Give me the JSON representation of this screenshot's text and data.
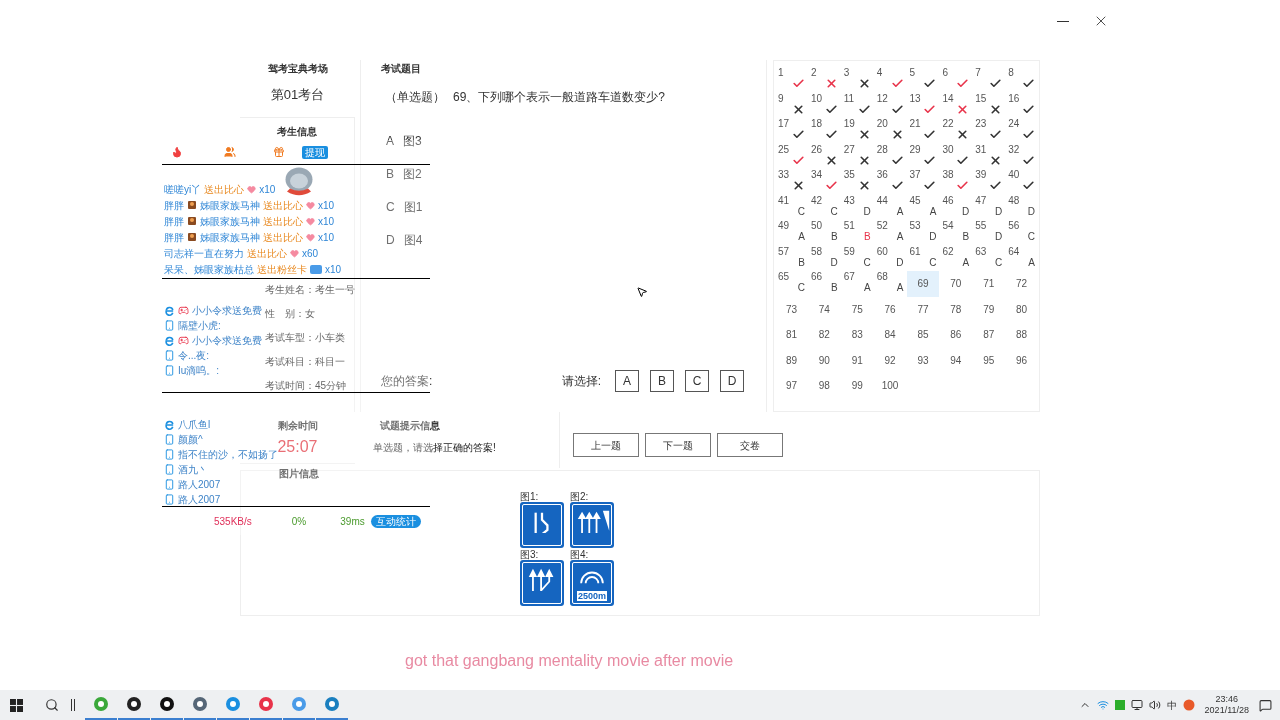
{
  "exam": {
    "site_title": "驾考宝典考场",
    "station": "第01考台",
    "candidate_heading": "考生信息",
    "candidate_fields": [
      {
        "label": "考生姓名：",
        "value": "考生一号"
      },
      {
        "label": "性　别：",
        "value": "女"
      },
      {
        "label": "考试车型：",
        "value": "小车类"
      },
      {
        "label": "考试科目：",
        "value": "科目一"
      },
      {
        "label": "考试时间：",
        "value": "45分钟"
      }
    ],
    "time_heading": "剩余时间",
    "time_left": "25:07",
    "image_heading": "图片信息"
  },
  "question": {
    "heading": "考试题目",
    "type": "（单选题）",
    "text": "69、下列哪个表示一般道路车道数变少?",
    "options": [
      {
        "letter": "A",
        "text": "图3"
      },
      {
        "letter": "B",
        "text": "图2"
      },
      {
        "letter": "C",
        "text": "图1"
      },
      {
        "letter": "D",
        "text": "图4"
      }
    ],
    "answer_label": "您的答案:",
    "choose_label": "请选择:",
    "choices": [
      {
        "label": "A",
        "selected": false
      },
      {
        "label": "B",
        "selected": false
      },
      {
        "label": "C",
        "selected": false
      },
      {
        "label": "D",
        "selected": false
      }
    ]
  },
  "hint": {
    "heading": "试题提示信息",
    "text": "单选题，请选择正确的答案!"
  },
  "nav_buttons": [
    "上一题",
    "下一题",
    "交卷"
  ],
  "answer_sheet": [
    {
      "number": "1",
      "kind": "check",
      "flagged": true,
      "selected": false
    },
    {
      "number": "2",
      "kind": "cross",
      "flagged": true,
      "selected": false
    },
    {
      "number": "3",
      "kind": "cross",
      "flagged": false,
      "selected": false
    },
    {
      "number": "4",
      "kind": "check",
      "flagged": true,
      "selected": false
    },
    {
      "number": "5",
      "kind": "check",
      "flagged": false,
      "selected": false
    },
    {
      "number": "6",
      "kind": "check",
      "flagged": true,
      "selected": false
    },
    {
      "number": "7",
      "kind": "check",
      "flagged": false,
      "selected": false
    },
    {
      "number": "8",
      "kind": "check",
      "flagged": false,
      "selected": false
    },
    {
      "number": "9",
      "kind": "cross",
      "flagged": false,
      "selected": false
    },
    {
      "number": "10",
      "kind": "check",
      "flagged": false,
      "selected": false
    },
    {
      "number": "11",
      "kind": "check",
      "flagged": false,
      "selected": false
    },
    {
      "number": "12",
      "kind": "check",
      "flagged": false,
      "selected": false
    },
    {
      "number": "13",
      "kind": "check",
      "flagged": true,
      "selected": false
    },
    {
      "number": "14",
      "kind": "cross",
      "flagged": true,
      "selected": false
    },
    {
      "number": "15",
      "kind": "cross",
      "flagged": false,
      "selected": false
    },
    {
      "number": "16",
      "kind": "check",
      "flagged": false,
      "selected": false
    },
    {
      "number": "17",
      "kind": "check",
      "flagged": false,
      "selected": false
    },
    {
      "number": "18",
      "kind": "check",
      "flagged": false,
      "selected": false
    },
    {
      "number": "19",
      "kind": "cross",
      "flagged": false,
      "selected": false
    },
    {
      "number": "20",
      "kind": "cross",
      "flagged": false,
      "selected": false
    },
    {
      "number": "21",
      "kind": "check",
      "flagged": false,
      "selected": false
    },
    {
      "number": "22",
      "kind": "cross",
      "flagged": false,
      "selected": false
    },
    {
      "number": "23",
      "kind": "check",
      "flagged": false,
      "selected": false
    },
    {
      "number": "24",
      "kind": "check",
      "flagged": false,
      "selected": false
    },
    {
      "number": "25",
      "kind": "check",
      "flagged": true,
      "selected": false
    },
    {
      "number": "26",
      "kind": "cross",
      "flagged": false,
      "selected": false
    },
    {
      "number": "27",
      "kind": "cross",
      "flagged": false,
      "selected": false
    },
    {
      "number": "28",
      "kind": "check",
      "flagged": false,
      "selected": false
    },
    {
      "number": "29",
      "kind": "check",
      "flagged": false,
      "selected": false
    },
    {
      "number": "30",
      "kind": "check",
      "flagged": false,
      "selected": false
    },
    {
      "number": "31",
      "kind": "cross",
      "flagged": false,
      "selected": false
    },
    {
      "number": "32",
      "kind": "check",
      "flagged": false,
      "selected": false
    },
    {
      "number": "33",
      "kind": "cross",
      "flagged": false,
      "selected": false
    },
    {
      "number": "34",
      "kind": "check",
      "flagged": true,
      "selected": false
    },
    {
      "number": "35",
      "kind": "cross",
      "flagged": false,
      "selected": false
    },
    {
      "number": "36",
      "kind": "check",
      "flagged": false,
      "selected": false
    },
    {
      "number": "37",
      "kind": "check",
      "flagged": false,
      "selected": false
    },
    {
      "number": "38",
      "kind": "check",
      "flagged": true,
      "selected": false
    },
    {
      "number": "39",
      "kind": "check",
      "flagged": false,
      "selected": false
    },
    {
      "number": "40",
      "kind": "check",
      "flagged": false,
      "selected": false
    },
    {
      "number": "41",
      "kind": "answer",
      "answer": "C",
      "flagged": false,
      "selected": false
    },
    {
      "number": "42",
      "kind": "answer",
      "answer": "C",
      "flagged": false,
      "selected": false
    },
    {
      "number": "43",
      "kind": "answer",
      "answer": "D",
      "flagged": false,
      "selected": false
    },
    {
      "number": "44",
      "kind": "answer",
      "answer": "A",
      "flagged": false,
      "selected": false
    },
    {
      "number": "45",
      "kind": "answer",
      "answer": "A",
      "flagged": false,
      "selected": false
    },
    {
      "number": "46",
      "kind": "answer",
      "answer": "D",
      "flagged": false,
      "selected": false
    },
    {
      "number": "47",
      "kind": "answer",
      "answer": "D",
      "flagged": false,
      "selected": false
    },
    {
      "number": "48",
      "kind": "answer",
      "answer": "D",
      "flagged": false,
      "selected": false
    },
    {
      "number": "49",
      "kind": "answer",
      "answer": "A",
      "flagged": false,
      "selected": false
    },
    {
      "number": "50",
      "kind": "answer",
      "answer": "B",
      "flagged": false,
      "selected": false
    },
    {
      "number": "51",
      "kind": "answer",
      "answer": "B",
      "flagged": true,
      "selected": false
    },
    {
      "number": "52",
      "kind": "answer",
      "answer": "A",
      "flagged": false,
      "selected": false
    },
    {
      "number": "53",
      "kind": "answer",
      "answer": "D",
      "flagged": false,
      "selected": false
    },
    {
      "number": "54",
      "kind": "answer",
      "answer": "B",
      "flagged": false,
      "selected": false
    },
    {
      "number": "55",
      "kind": "answer",
      "answer": "D",
      "flagged": false,
      "selected": false
    },
    {
      "number": "56",
      "kind": "answer",
      "answer": "C",
      "flagged": false,
      "selected": false
    },
    {
      "number": "57",
      "kind": "answer",
      "answer": "B",
      "flagged": false,
      "selected": false
    },
    {
      "number": "58",
      "kind": "answer",
      "answer": "D",
      "flagged": false,
      "selected": false
    },
    {
      "number": "59",
      "kind": "answer",
      "answer": "C",
      "flagged": false,
      "selected": false
    },
    {
      "number": "60",
      "kind": "answer",
      "answer": "D",
      "flagged": false,
      "selected": false
    },
    {
      "number": "61",
      "kind": "answer",
      "answer": "C",
      "flagged": false,
      "selected": false
    },
    {
      "number": "62",
      "kind": "answer",
      "answer": "A",
      "flagged": false,
      "selected": false
    },
    {
      "number": "63",
      "kind": "answer",
      "answer": "C",
      "flagged": false,
      "selected": false
    },
    {
      "number": "64",
      "kind": "answer",
      "answer": "A",
      "flagged": false,
      "selected": false
    },
    {
      "number": "65",
      "kind": "answer",
      "answer": "C",
      "flagged": false,
      "selected": false
    },
    {
      "number": "66",
      "kind": "answer",
      "answer": "B",
      "flagged": false,
      "selected": false
    },
    {
      "number": "67",
      "kind": "answer",
      "answer": "A",
      "flagged": false,
      "selected": false
    },
    {
      "number": "68",
      "kind": "answer",
      "answer": "A",
      "flagged": false,
      "selected": false
    },
    {
      "number": "69",
      "kind": "empty",
      "selected": true
    },
    {
      "number": "70",
      "kind": "empty",
      "selected": false
    },
    {
      "number": "71",
      "kind": "empty",
      "selected": false
    },
    {
      "number": "72",
      "kind": "empty",
      "selected": false
    },
    {
      "number": "73",
      "kind": "empty",
      "selected": false
    },
    {
      "number": "74",
      "kind": "empty",
      "selected": false
    },
    {
      "number": "75",
      "kind": "empty",
      "selected": false
    },
    {
      "number": "76",
      "kind": "empty",
      "selected": false
    },
    {
      "number": "77",
      "kind": "empty",
      "selected": false
    },
    {
      "number": "78",
      "kind": "empty",
      "selected": false
    },
    {
      "number": "79",
      "kind": "empty",
      "selected": false
    },
    {
      "number": "80",
      "kind": "empty",
      "selected": false
    },
    {
      "number": "81",
      "kind": "empty",
      "selected": false
    },
    {
      "number": "82",
      "kind": "empty",
      "selected": false
    },
    {
      "number": "83",
      "kind": "empty",
      "selected": false
    },
    {
      "number": "84",
      "kind": "empty",
      "selected": false
    },
    {
      "number": "85",
      "kind": "empty",
      "selected": false
    },
    {
      "number": "86",
      "kind": "empty",
      "selected": false
    },
    {
      "number": "87",
      "kind": "empty",
      "selected": false
    },
    {
      "number": "88",
      "kind": "empty",
      "selected": false
    },
    {
      "number": "89",
      "kind": "empty",
      "selected": false
    },
    {
      "number": "90",
      "kind": "empty",
      "selected": false
    },
    {
      "number": "91",
      "kind": "empty",
      "selected": false
    },
    {
      "number": "92",
      "kind": "empty",
      "selected": false
    },
    {
      "number": "93",
      "kind": "empty",
      "selected": false
    },
    {
      "number": "94",
      "kind": "empty",
      "selected": false
    },
    {
      "number": "95",
      "kind": "empty",
      "selected": false
    },
    {
      "number": "96",
      "kind": "empty",
      "selected": false
    },
    {
      "number": "97",
      "kind": "empty",
      "selected": false
    },
    {
      "number": "98",
      "kind": "empty",
      "selected": false
    },
    {
      "number": "99",
      "kind": "empty",
      "selected": false
    },
    {
      "number": "100",
      "kind": "empty",
      "selected": false
    }
  ],
  "images": [
    {
      "label": "图1:",
      "kind": "bend"
    },
    {
      "label": "图2:",
      "kind": "merge"
    },
    {
      "label": "图3:",
      "kind": "split"
    },
    {
      "label": "图4:",
      "kind": "tunnel",
      "sign_text": "2500m"
    }
  ],
  "overlay": {
    "withdraw_button": "提现",
    "chat_blocks": [
      [
        {
          "kind": "heart",
          "user": "嗟嗟yi丫",
          "badge": false,
          "action": "送出比心",
          "count": "x10"
        },
        {
          "kind": "heart",
          "user": "胖胖",
          "badge": true,
          "name": "姊眼家族马神",
          "action": "送出比心",
          "count": "x10"
        },
        {
          "kind": "heart",
          "user": "胖胖",
          "badge": true,
          "name": "姊眼家族马神",
          "action": "送出比心",
          "count": "x10"
        },
        {
          "kind": "heart",
          "user": "胖胖",
          "badge": true,
          "name": "姊眼家族马神",
          "action": "送出比心",
          "count": "x10"
        },
        {
          "kind": "heart",
          "user": "司志祥一直在努力",
          "badge": false,
          "action": "送出比心",
          "count": "x60"
        },
        {
          "kind": "card",
          "user": "呆呆、姊眼家族枯总",
          "badge": false,
          "action": "送出粉丝卡",
          "count": "x10"
        }
      ],
      [
        {
          "kind": "pc",
          "game": true,
          "text": "小小令求送免费"
        },
        {
          "kind": "mobile",
          "game": false,
          "text": "隔壁小虎:"
        },
        {
          "kind": "pc",
          "game": true,
          "text": "小小令求送免费"
        },
        {
          "kind": "mobile",
          "game": false,
          "text": "令...夜:"
        },
        {
          "kind": "mobile",
          "game": false,
          "text": "Iu滴呜。:"
        }
      ],
      [
        {
          "kind": "pc",
          "game": false,
          "text": "八爪鱼l"
        },
        {
          "kind": "mobile",
          "game": false,
          "text": "颜颜^"
        },
        {
          "kind": "mobile",
          "game": false,
          "text": "指不住的沙，不如扬了"
        },
        {
          "kind": "mobile",
          "game": false,
          "text": "酒九丶"
        },
        {
          "kind": "mobile",
          "game": false,
          "text": "路人2007"
        },
        {
          "kind": "mobile",
          "game": false,
          "text": "路人2007"
        }
      ]
    ],
    "stats": {
      "speed": "535KB/s",
      "loss": "0%",
      "ping": "39ms",
      "button": "互动统计"
    }
  },
  "caption": "got that gangbang mentality movie after movie",
  "taskbar": {
    "ime": "中",
    "time": "23:46",
    "date": "2021/11/28"
  }
}
